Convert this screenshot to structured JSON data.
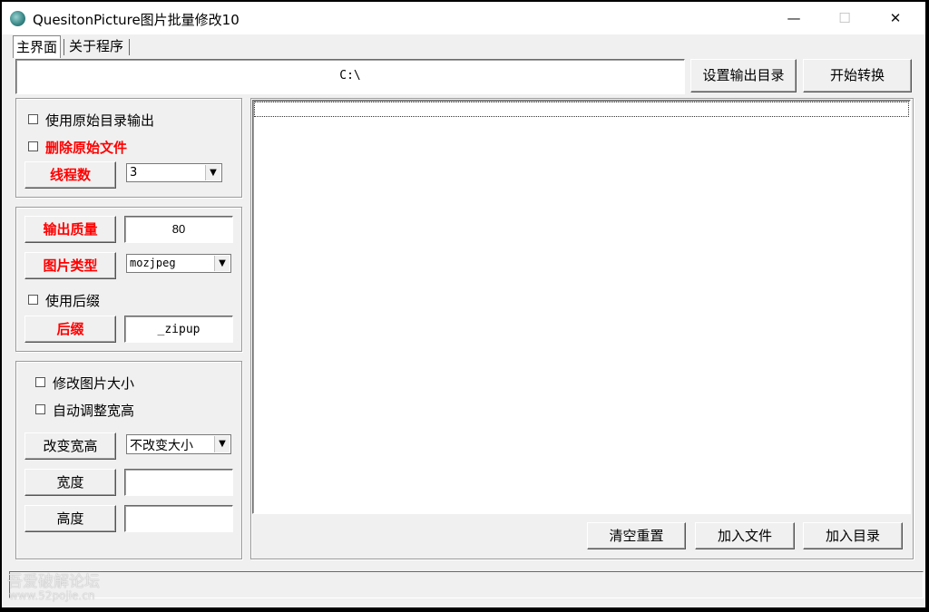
{
  "window": {
    "title": "QuesitonPicture图片批量修改10",
    "minimize_glyph": "—",
    "maximize_glyph": "☐",
    "close_glyph": "✕"
  },
  "tabs": [
    {
      "label": "主界面",
      "active": true
    },
    {
      "label": "关于程序",
      "active": false
    }
  ],
  "output_dir": {
    "path": "C:\\",
    "set_button": "设置输出目录",
    "start_button": "开始转换"
  },
  "group1": {
    "use_original_dir": {
      "label": "使用原始目录输出",
      "checked": false
    },
    "delete_original": {
      "label": "删除原始文件",
      "checked": false
    },
    "threads_button": "线程数",
    "threads_value": "3"
  },
  "group2": {
    "quality_button": "输出质量",
    "quality_value": "80",
    "type_button": "图片类型",
    "type_value": "mozjpeg",
    "use_suffix": {
      "label": "使用后缀",
      "checked": false
    },
    "suffix_button": "后缀",
    "suffix_value": "_zipup"
  },
  "group3": {
    "resize": {
      "label": "修改图片大小",
      "checked": false
    },
    "auto_adjust": {
      "label": "自动调整宽高",
      "checked": false
    },
    "change_size_button": "改变宽高",
    "size_mode_value": "不改变大小",
    "width_button": "宽度",
    "width_value": "",
    "height_button": "高度",
    "height_value": ""
  },
  "file_list": {
    "clear_button": "清空重置",
    "add_file_button": "加入文件",
    "add_dir_button": "加入目录"
  },
  "watermark": {
    "line1": "吾爱破解论坛",
    "line2": "www.52pojie.cn"
  },
  "colors": {
    "accent_red": "#ff0000",
    "window_bg": "#f0f0f0"
  },
  "icons": [
    "app-icon",
    "dropdown-arrow-icon"
  ]
}
